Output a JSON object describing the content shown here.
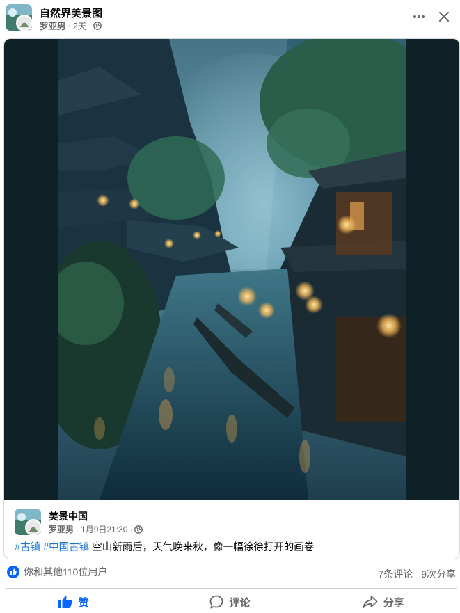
{
  "header": {
    "group_name": "自然界美景图",
    "author": "罗亚男",
    "time": "2天",
    "separator": "·"
  },
  "post": {
    "image_alt": "古镇夜景：雨雾中的水乡街道与灯笼"
  },
  "shared_post": {
    "page_name": "美景中国",
    "author": "罗亚男",
    "time": "1月9日21:30",
    "separator": "·",
    "hashtags": [
      "#古镇",
      "#中国古镇"
    ],
    "text": "空山新雨后，天气晚来秋，像一幅徐徐打开的画卷"
  },
  "stats": {
    "reactions": "你和其他110位用户",
    "comments": "7条评论",
    "shares": "9次分享"
  },
  "actions": {
    "like": "赞",
    "comment": "评论",
    "share": "分享"
  },
  "colors": {
    "accent": "#0866ff",
    "hashtag": "#1876d4",
    "muted": "#65676b"
  }
}
